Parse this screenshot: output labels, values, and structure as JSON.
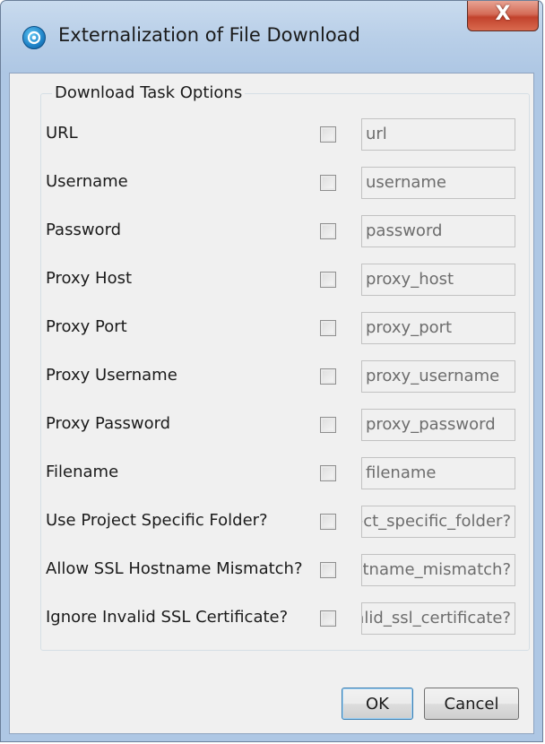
{
  "window": {
    "title": "Externalization of File Download",
    "close_label": "X"
  },
  "group": {
    "label": "Download Task Options"
  },
  "rows": [
    {
      "label": "URL",
      "value": "url"
    },
    {
      "label": "Username",
      "value": "username"
    },
    {
      "label": "Password",
      "value": "password"
    },
    {
      "label": "Proxy Host",
      "value": "proxy_host"
    },
    {
      "label": "Proxy Port",
      "value": "proxy_port"
    },
    {
      "label": "Proxy Username",
      "value": "proxy_username"
    },
    {
      "label": "Proxy Password",
      "value": "proxy_password"
    },
    {
      "label": "Filename",
      "value": "filename"
    },
    {
      "label": "Use Project Specific Folder?",
      "value": "use_project_specific_folder?"
    },
    {
      "label": "Allow SSL Hostname Mismatch?",
      "value": "allow_ssl_hostname_mismatch?"
    },
    {
      "label": "Ignore Invalid SSL Certificate?",
      "value": "ignore_invalid_ssl_certificate?"
    }
  ],
  "buttons": {
    "ok": "OK",
    "cancel": "Cancel"
  },
  "icons": {
    "title_icon": "app-logo-icon",
    "close_icon": "close-icon"
  }
}
